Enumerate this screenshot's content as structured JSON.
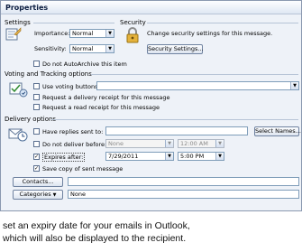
{
  "window": {
    "title": "Properties"
  },
  "settings": {
    "section_label": "Settings",
    "importance_label": "Importance:",
    "importance_value": "Normal",
    "sensitivity_label": "Sensitivity:",
    "sensitivity_value": "Normal",
    "no_autoarchive_label": "Do not AutoArchive this item"
  },
  "security": {
    "section_label": "Security",
    "description": "Change security settings for this message.",
    "button_label": "Security Settings..."
  },
  "voting": {
    "section_label": "Voting and Tracking options",
    "use_voting_label": "Use voting buttons:",
    "voting_value": "",
    "delivery_receipt_label": "Request a delivery receipt for this message",
    "read_receipt_label": "Request a read receipt for this message"
  },
  "delivery": {
    "section_label": "Delivery options",
    "replies_label": "Have replies sent to:",
    "replies_value": "",
    "select_names_label": "Select Names...",
    "do_not_deliver_label": "Do not deliver before:",
    "do_not_deliver_date": "None",
    "do_not_deliver_time": "12:00 AM",
    "expires_label": "Expires after:",
    "expires_date": "7/29/2011",
    "expires_time": "5:00 PM",
    "expires_checked": true,
    "save_copy_label": "Save copy of sent message",
    "save_copy_checked": true,
    "contacts_label": "Contacts...",
    "contacts_value": "",
    "categories_label": "Categories",
    "categories_value": "None"
  },
  "caption": {
    "line1": "set an expiry date for your emails in Outlook,",
    "line2": "which will also be displayed to the recipient."
  }
}
